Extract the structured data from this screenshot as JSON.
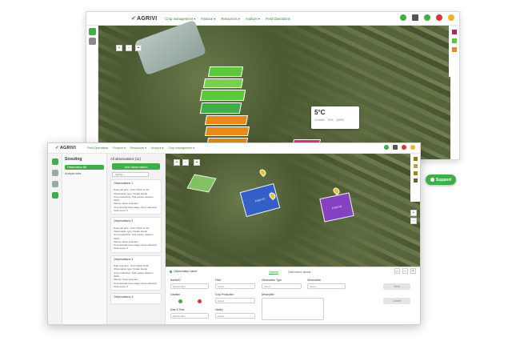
{
  "back": {
    "logo": "AGRIVI",
    "nav": [
      "Crop management ▾",
      "Finance ▾",
      "Resources ▾",
      "Analyze ▾",
      "Field Operations"
    ],
    "weather": {
      "temp": "5°C",
      "wind": "10 km/h",
      "humidity": "76%",
      "pressure": "100%"
    }
  },
  "front": {
    "logo": "AGRIVI",
    "nav": [
      "Field Operations",
      "Finance ▾",
      "Resources ▾",
      "Analyze ▾",
      "Crop management ▾"
    ],
    "panel1": {
      "title": "Scouting",
      "items": [
        "Observation list",
        "Analyze data"
      ]
    },
    "panel2": {
      "title": "All observations (11)",
      "add_button": "Add observation",
      "sort": "Sort by ↓",
      "cards": [
        {
          "title": "Observations 1",
          "lines": [
            "Date and time: 14.07.2023 17:00",
            "Observation type: Potato beetle",
            "Crop production: Soft potato, Season 2023",
            "Variety: None selected",
            "Crop development stage: None selected",
            "Total count: 5"
          ]
        },
        {
          "title": "Observations 2",
          "lines": [
            "Date and time: 14.07.2023 17:00",
            "Observation type: Potato beetle",
            "Crop production: Soft potato, Season 2023",
            "Variety: None selected",
            "Crop development stage: None selected",
            "Total count: 5"
          ]
        },
        {
          "title": "Observations 3",
          "lines": [
            "Date and time: 14.07.2023 17:00",
            "Observation type: Potato beetle",
            "Crop production: Soft potato, Season 2023",
            "Variety: None selected",
            "Crop development stage: None selected",
            "Total count: 5"
          ]
        },
        {
          "title": "Observations 4",
          "lines": []
        }
      ]
    },
    "form": {
      "header": "Observation name",
      "tabs": [
        "General",
        "Observation details"
      ],
      "name_label": "Name/ID",
      "name_value": "Placeholder",
      "field_label": "Field",
      "field_value": "Select",
      "obs_type_label": "Observation Type",
      "obs_type_value": "Select",
      "observation_label": "Observation",
      "observation_value": "Select",
      "location_label": "Location",
      "crop_label": "Crop Production",
      "crop_value": "Select",
      "description_label": "Description",
      "date_label": "Date & Time",
      "date_value": "Placeholder",
      "variety_label": "Variety",
      "variety_value": "Select",
      "save_label": "Save",
      "cancel_label": "Cancel"
    },
    "support_label": "Support"
  },
  "colors": {
    "brand": "#3fae49",
    "field_green": "#5cc93a",
    "field_orange": "#e88a1a",
    "field_blue": "#2f5fd6",
    "field_purple": "#8a3fd1",
    "field_pink": "#d63a7a"
  }
}
